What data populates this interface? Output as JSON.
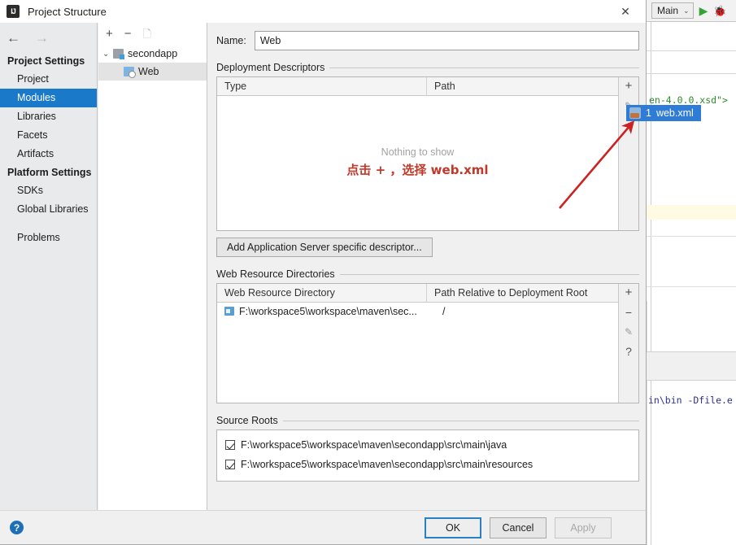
{
  "dialog": {
    "title": "Project Structure",
    "app_icon": "intellij-idea-icon",
    "close_icon": "✕",
    "nav_back_icon": "←",
    "nav_forward_icon": "→"
  },
  "sidebar": {
    "sections": [
      {
        "header": "Project Settings",
        "items": [
          {
            "label": "Project",
            "selected": false
          },
          {
            "label": "Modules",
            "selected": true
          },
          {
            "label": "Libraries",
            "selected": false
          },
          {
            "label": "Facets",
            "selected": false
          },
          {
            "label": "Artifacts",
            "selected": false
          }
        ]
      },
      {
        "header": "Platform Settings",
        "items": [
          {
            "label": "SDKs",
            "selected": false
          },
          {
            "label": "Global Libraries",
            "selected": false
          }
        ]
      }
    ],
    "problems_label": "Problems"
  },
  "tree": {
    "toolbar": {
      "add_icon": "+",
      "remove_icon": "−",
      "copy_icon": "copy-icon"
    },
    "nodes": [
      {
        "label": "secondapp",
        "icon": "module-icon",
        "expanded": true,
        "selected": false
      },
      {
        "label": "Web",
        "icon": "web-facet-icon",
        "child": true,
        "selected": true
      }
    ],
    "expand_glyph": "⌄"
  },
  "main": {
    "name_label": "Name:",
    "name_value": "Web",
    "deployment": {
      "group_label": "Deployment Descriptors",
      "columns": [
        "Type",
        "Path"
      ],
      "empty_text": "Nothing to show",
      "annotation_text": "点击 + ，选择 web.xml",
      "rows": [],
      "tools": {
        "add": "+",
        "edit": "pencil-icon"
      },
      "add_descriptor_button": "Add Application Server specific descriptor..."
    },
    "web_resources": {
      "group_label": "Web Resource Directories",
      "columns": [
        "Web Resource Directory",
        "Path Relative to Deployment Root"
      ],
      "rows": [
        {
          "directory": "F:\\workspace5\\workspace\\maven\\sec...",
          "path": "/"
        }
      ],
      "tools": {
        "add": "+",
        "remove": "−",
        "edit": "pencil-icon",
        "help": "?"
      }
    },
    "source_roots": {
      "group_label": "Source Roots",
      "rows": [
        {
          "path": "F:\\workspace5\\workspace\\maven\\secondapp\\src\\main\\java",
          "checked": true
        },
        {
          "path": "F:\\workspace5\\workspace\\maven\\secondapp\\src\\main\\resources",
          "checked": true
        }
      ]
    }
  },
  "footer": {
    "help_icon": "?",
    "ok_label": "OK",
    "cancel_label": "Cancel",
    "apply_label": "Apply"
  },
  "popup": {
    "index": "1",
    "label": "web.xml",
    "icon": "xml-file-icon"
  },
  "ide_background": {
    "run_config": "Main",
    "run_config_chevron": "⌄",
    "run_icon": "▶",
    "debug_icon": "debug-icon",
    "code_line_1": "en-4.0.0.xsd\">",
    "code_line_2": "in\\bin -Dfile.e"
  },
  "colors": {
    "selection_blue": "#1a7ac9",
    "annotation_red": "#c0392b",
    "accent_green": "#36a336",
    "popup_blue": "#2f7cd6"
  }
}
